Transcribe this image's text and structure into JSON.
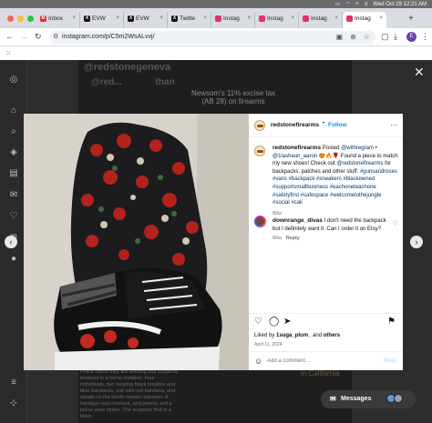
{
  "menubar": {
    "datetime": "Wed Oct 29  12:21 AM"
  },
  "tabs": [
    {
      "label": "Inbox",
      "color": "#d93025",
      "glyph": "M"
    },
    {
      "label": "EVW",
      "color": "#111111",
      "glyph": "X"
    },
    {
      "label": "EVW",
      "color": "#111111",
      "glyph": "X"
    },
    {
      "label": "Twitte",
      "color": "#111111",
      "glyph": "X"
    },
    {
      "label": "Instag",
      "color": "#e1306c",
      "glyph": ""
    },
    {
      "label": "Instag",
      "color": "#e1306c",
      "glyph": ""
    },
    {
      "label": "Instag",
      "color": "#e1306c",
      "glyph": ""
    },
    {
      "label": "Instag",
      "color": "#e1306c",
      "glyph": ""
    }
  ],
  "address": {
    "url": "instagram.com/p/C5m2WsALvvj/"
  },
  "profile_initial": "E",
  "background": {
    "handle": "@redstonegeneva",
    "handle2": "@red...",
    "handle2_suffix": "than",
    "news": "Newsom's 11% excise tax (AB 28) on firearms",
    "caption": "Police report they are seeking four suspects involved in a home invasion. Four individuals, two wearing black hoodies and blue bandanas, one with red bandana, and details on the fourth remain unknown. A handgun was involved, and jewelry and a purse were stolen. The suspects fled in a black",
    "california": "in California"
  },
  "post": {
    "username": "redstonefirearms",
    "follow_label": "Follow",
    "caption_user": "redstonefirearms",
    "caption_prefix": "Posted",
    "caption_mention1": "@withregram",
    "caption_sep": "•",
    "caption_mention2": "@1lashaun_aaron",
    "caption_emoji": "😍🔥🌹",
    "caption_text1": "Found a piece to match my new shoes! Check out",
    "caption_mention3": "@redstonefirearms",
    "caption_text2": "for backpacks, patches and other stuff.",
    "caption_tags": "#gunsandroses #vans #backpack #sneakers #blackowned #supportsmallbusiness #eachoneteachone #safetyfirst #safespace #welcometothejungle #social #cali",
    "caption_age": "80w",
    "comment_user": "downrange_divas",
    "comment_text": "I don't need the backpack but I definitely want it. Can I order it on Etsy?",
    "comment_age": "80w",
    "comment_reply": "Reply",
    "liked_prefix": "Liked by",
    "liked_user": "1suga_plum_",
    "liked_suffix": "and",
    "liked_others": "others",
    "date": "April 11, 2024",
    "add_comment_placeholder": "Add a comment...",
    "post_label": "Post"
  },
  "messages_label": "Messages",
  "colors": {
    "accent": "#0095f6",
    "link": "#00376b"
  }
}
